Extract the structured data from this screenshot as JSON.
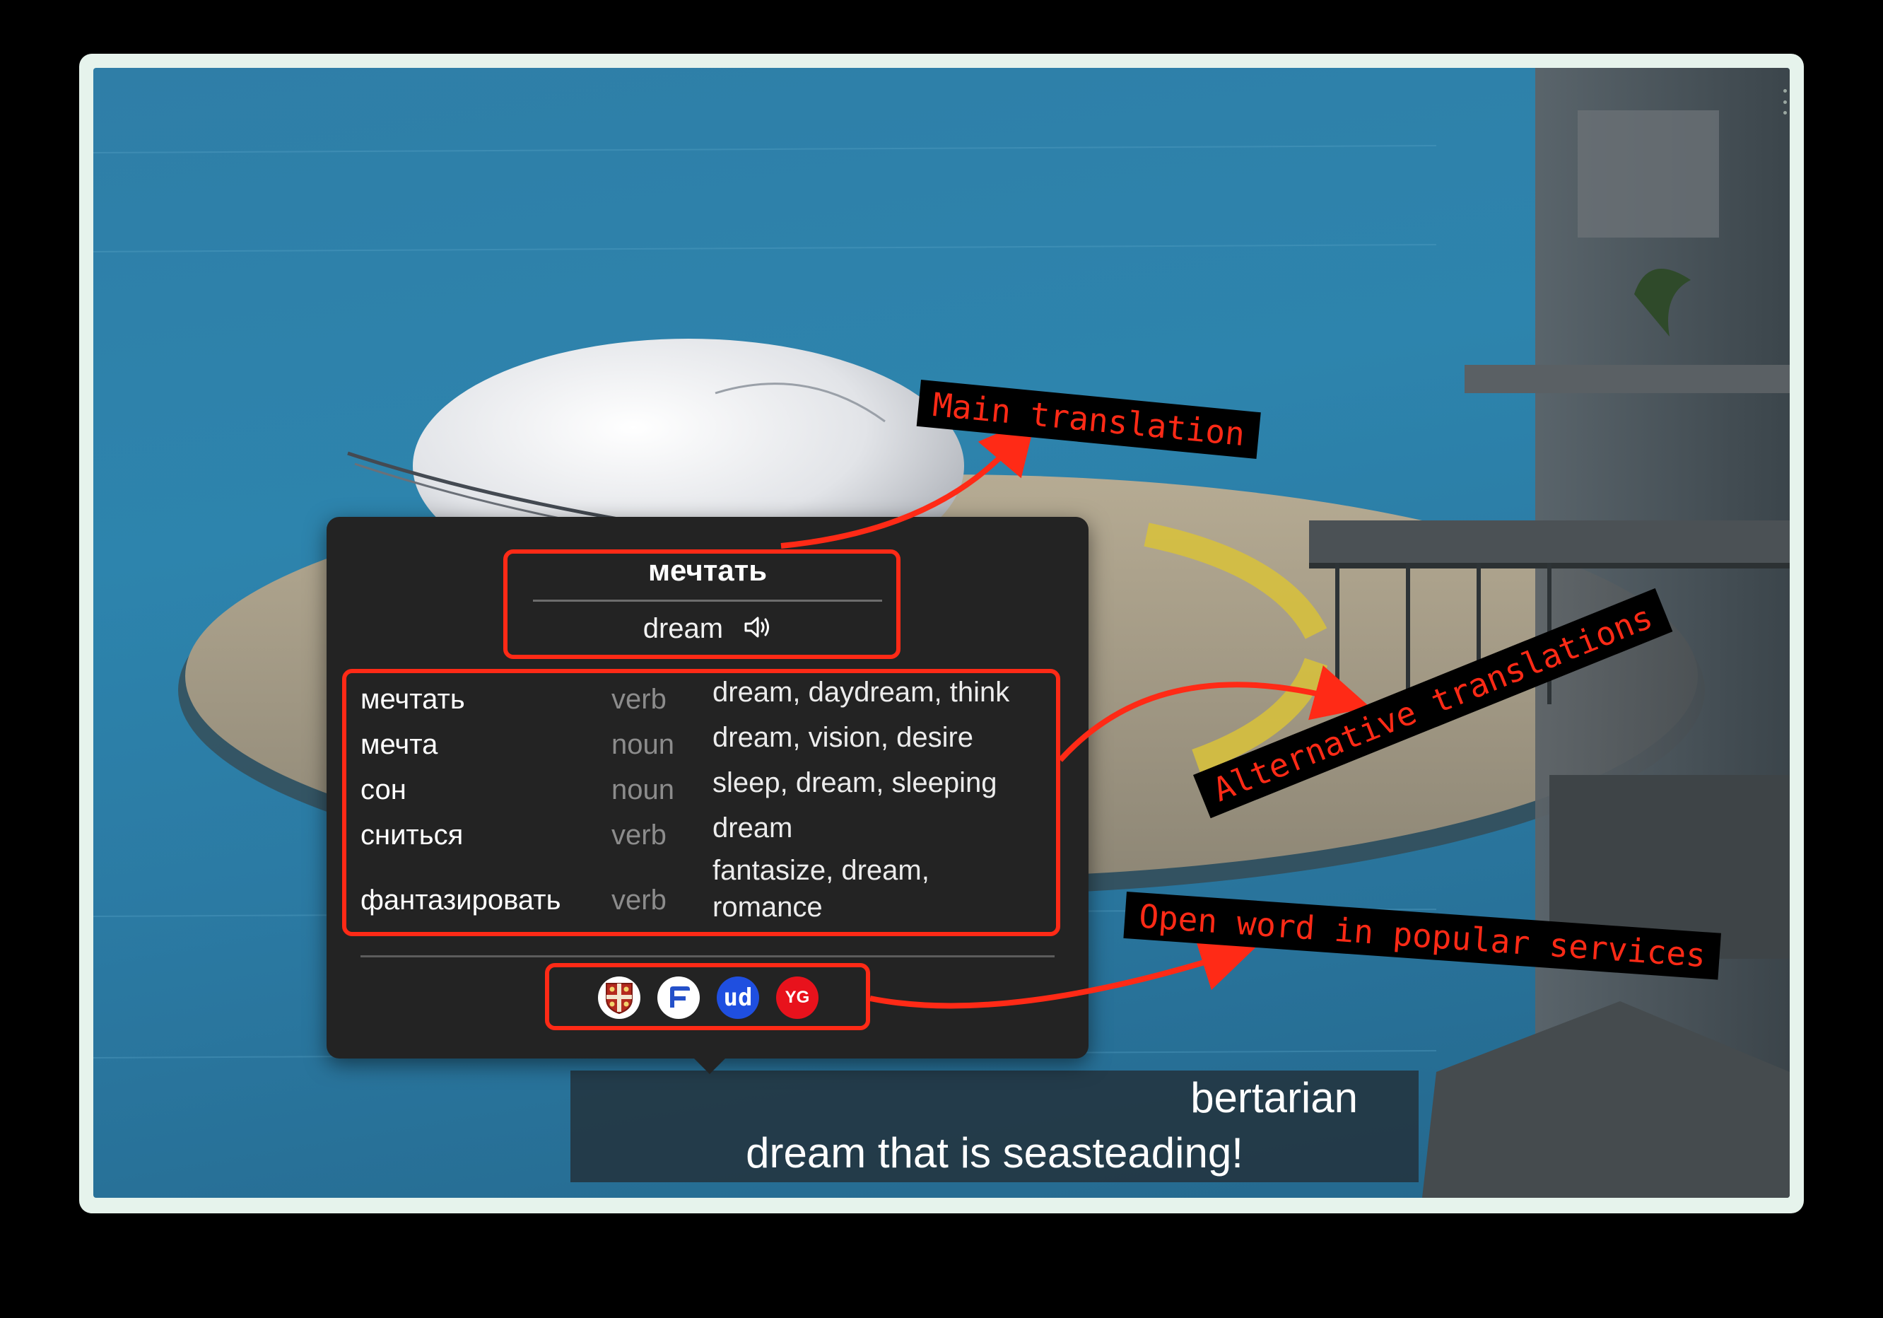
{
  "popup": {
    "main_word": "мечтать",
    "main_translation": "dream",
    "alternatives": [
      {
        "word": "мечтать",
        "pos": "verb",
        "translations": "dream, daydream, think"
      },
      {
        "word": "мечта",
        "pos": "noun",
        "translations": "dream, vision, desire"
      },
      {
        "word": "сон",
        "pos": "noun",
        "translations": "sleep, dream, sleeping"
      },
      {
        "word": "сниться",
        "pos": "verb",
        "translations": "dream"
      },
      {
        "word": "фантазировать",
        "pos": "verb",
        "translations": "fantasize, dream, romance"
      }
    ],
    "services": [
      {
        "name": "Cambridge",
        "icon": "cambridge-crest-icon"
      },
      {
        "name": "Forvo",
        "icon": "forvo-icon"
      },
      {
        "name": "Urban Dictionary",
        "icon": "ud-icon",
        "text": "ud"
      },
      {
        "name": "YouGlish",
        "icon": "youglish-icon",
        "text": "YG"
      }
    ]
  },
  "subtitles": {
    "line1": "bertarian",
    "line2": "dream that is seasteading!"
  },
  "annotations": {
    "main_translation": "Main translation",
    "alternative_translations": "Alternative translations",
    "open_word": "Open word in popular services"
  },
  "colors": {
    "highlight": "#ff2a16",
    "popup_bg": "#232323",
    "frame": "#e6f3ec"
  }
}
